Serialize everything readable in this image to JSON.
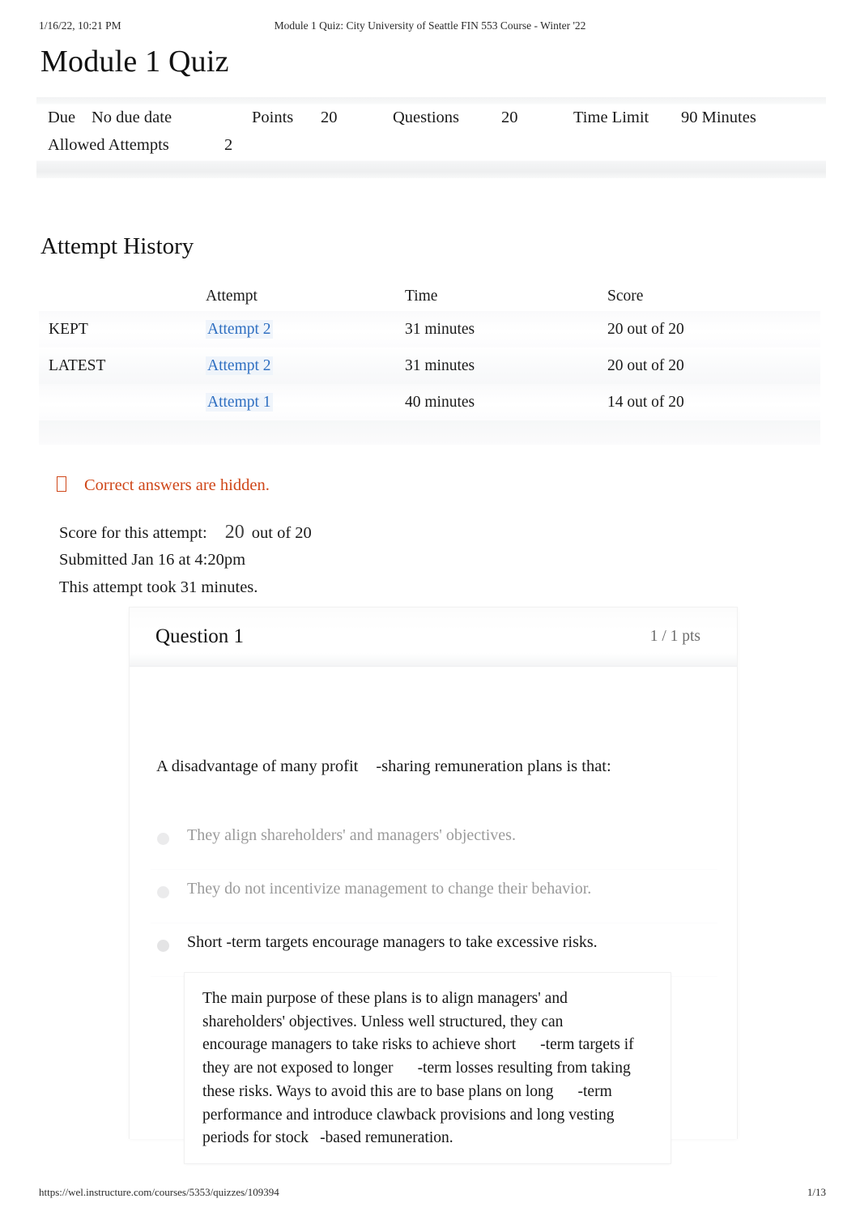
{
  "print_header": {
    "date": "1/16/22, 10:21 PM",
    "title": "Module 1 Quiz: City University of Seattle FIN 553 Course - Winter '22"
  },
  "page_title": "Module 1 Quiz",
  "quiz_details": {
    "due_label": "Due",
    "due_value": "No due date",
    "points_label": "Points",
    "points_value": "20",
    "questions_label": "Questions",
    "questions_value": "20",
    "time_limit_label": "Time Limit",
    "time_limit_value": "90 Minutes",
    "allowed_attempts_label": "Allowed Attempts",
    "allowed_attempts_value": "2"
  },
  "attempt_history": {
    "heading": "Attempt History",
    "columns": [
      "",
      "Attempt",
      "Time",
      "Score"
    ],
    "rows": [
      {
        "label": "KEPT",
        "attempt": "Attempt 2",
        "time": "31 minutes",
        "score": "20 out of 20"
      },
      {
        "label": "LATEST",
        "attempt": "Attempt 2",
        "time": "31 minutes",
        "score": "20 out of 20"
      },
      {
        "label": "",
        "attempt": "Attempt 1",
        "time": "40 minutes",
        "score": "14 out of 20"
      }
    ]
  },
  "hidden_warning": {
    "icon": "warning-icon",
    "text": "Correct answers are hidden."
  },
  "score_summary": {
    "score_label": "Score for this attempt:",
    "score_value": "20",
    "score_out_of": "out of 20",
    "submitted": "Submitted Jan 16 at 4:20pm",
    "duration": "This attempt took 31 minutes."
  },
  "question": {
    "title": "Question 1",
    "points": "1 / 1 pts",
    "prompt_part1": "A disadvantage of many profit",
    "prompt_part2": "-sharing remuneration plans is that:",
    "answers": [
      {
        "text": "They align shareholders' and managers' objectives.",
        "state": "dim"
      },
      {
        "text": "They do not incentivize management to change their behavior.",
        "state": "dim"
      },
      {
        "text": "Short -term targets encourage managers to take excessive risks.",
        "state": "selected"
      }
    ],
    "explanation_lines": [
      {
        "a": "The main purpose of these plans is to align managers' and",
        "b": "",
        "c": ""
      },
      {
        "a": "shareholders' objectives. Unless well structured, they can",
        "b": "",
        "c": ""
      },
      {
        "a": "encourage managers to take risks to achieve short",
        "b": "-term targets if",
        "c": ""
      },
      {
        "a": "they are not exposed to longer",
        "b": "-term losses resulting from taking",
        "c": ""
      },
      {
        "a": "these risks. Ways to avoid this are to base plans on long",
        "b": "-term",
        "c": ""
      },
      {
        "a": "performance and introduce clawback provisions and long vesting",
        "b": "",
        "c": ""
      },
      {
        "a": "periods for stock",
        "b": "",
        "c": "-based remuneration."
      }
    ]
  },
  "print_footer": {
    "url": "https://wel.instructure.com/courses/5353/quizzes/109394",
    "page": "1/13"
  },
  "colors": {
    "link": "#2f6fc1",
    "warning": "#cf4618",
    "muted": "#9b9b9b",
    "points": "#6d6d6d"
  }
}
